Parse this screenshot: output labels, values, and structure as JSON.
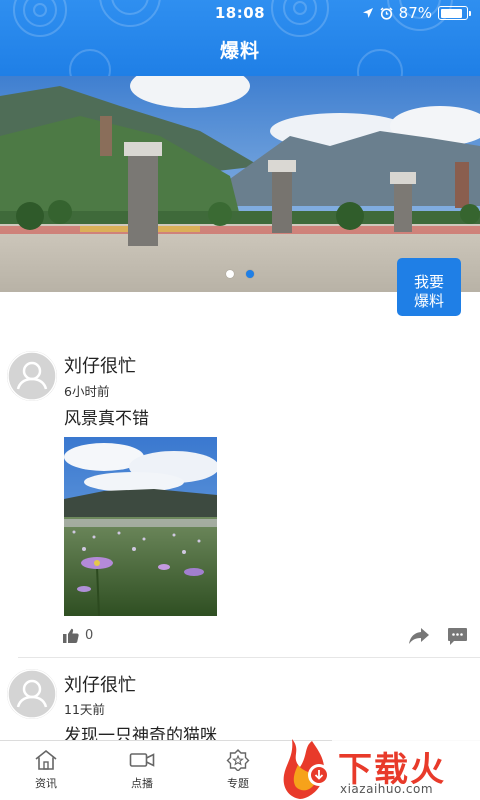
{
  "status": {
    "time": "18:08",
    "battery": "87%",
    "battery_level": 0.87
  },
  "header": {
    "title": "爆料"
  },
  "banner": {
    "slide_count": 2,
    "active_index": 1
  },
  "report_button": {
    "line1": "我要",
    "line2": "爆料"
  },
  "posts": [
    {
      "author": "刘仔很忙",
      "time": "6小时前",
      "text": "风景真不错",
      "likes": "0",
      "has_photo": true
    },
    {
      "author": "刘仔很忙",
      "time": "11天前",
      "text": "发现一只神奇的猫咪"
    }
  ],
  "nav": [
    {
      "label": "资讯",
      "icon": "home-icon"
    },
    {
      "label": "点播",
      "icon": "video-icon"
    },
    {
      "label": "专题",
      "icon": "badge-icon"
    }
  ],
  "watermark": {
    "text": "下载火",
    "domain": "xiazaihuo.com",
    "color": "#e83a2a"
  },
  "colors": {
    "primary": "#1f7fe6",
    "divider": "#e6e6e6"
  }
}
